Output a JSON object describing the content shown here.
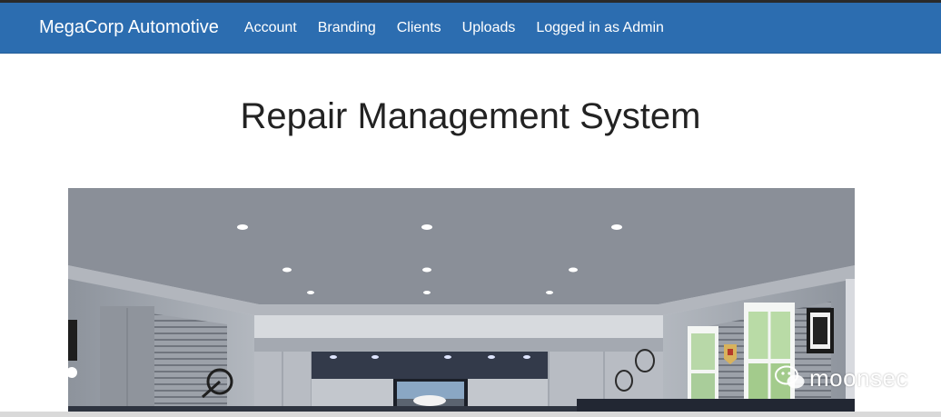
{
  "navbar": {
    "brand": "MegaCorp Automotive",
    "items": [
      {
        "label": "Account"
      },
      {
        "label": "Branding"
      },
      {
        "label": "Clients"
      },
      {
        "label": "Uploads"
      }
    ],
    "status": "Logged in as Admin"
  },
  "main": {
    "title": "Repair Management System"
  },
  "watermark": {
    "text": "moonsec"
  },
  "colors": {
    "navbar": "#2c6db0",
    "text": "#222222"
  }
}
